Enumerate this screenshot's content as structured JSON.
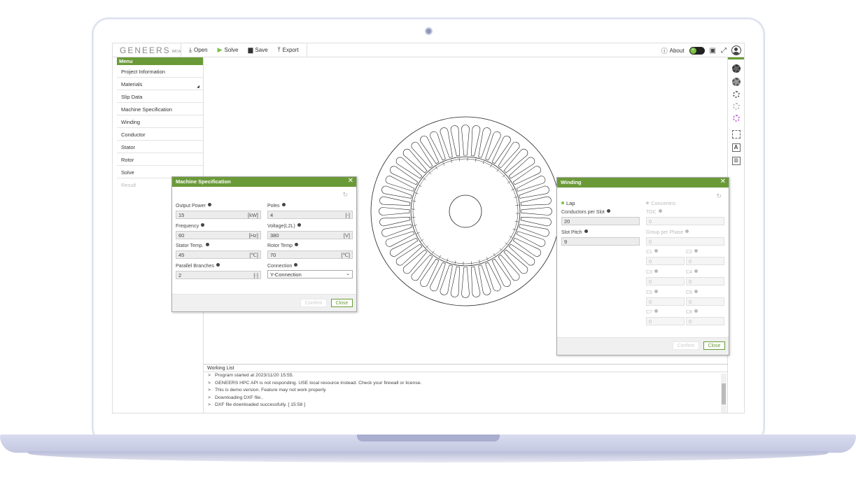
{
  "app": {
    "logo_text": "GENEERS",
    "logo_sub": "IMCA"
  },
  "toolbar": {
    "open_label": "Open",
    "solve_label": "Solve",
    "save_label": "Save",
    "export_label": "Export",
    "about_label": "About",
    "accent": "#6a9a38"
  },
  "sidebar": {
    "header": "Menu",
    "items": [
      {
        "label": "Project Information"
      },
      {
        "label": "Materials"
      },
      {
        "label": "Slip Data"
      },
      {
        "label": "Machine Specification"
      },
      {
        "label": "Winding"
      },
      {
        "label": "Conductor"
      },
      {
        "label": "Stator"
      },
      {
        "label": "Rotor"
      },
      {
        "label": "Solve"
      },
      {
        "label": "Result"
      }
    ]
  },
  "right_rail": {
    "icons": [
      "rotor-full-icon",
      "rotor-outline-icon",
      "stator-gear-icon",
      "stator-light-icon",
      "stator-highlight-icon",
      "fit-view-icon",
      "text-icon",
      "chart-icon"
    ]
  },
  "machine_spec": {
    "title": "Machine Specification",
    "output_power": {
      "label": "Output Power",
      "value": "15",
      "unit": "[kW]"
    },
    "poles": {
      "label": "Poles",
      "value": "4",
      "unit": "[-]"
    },
    "frequency": {
      "label": "Frequency",
      "value": "60",
      "unit": "[Hz]"
    },
    "voltage": {
      "label": "Voltage(L2L)",
      "value": "380",
      "unit": "[V]"
    },
    "stator_temp": {
      "label": "Stator Temp.",
      "value": "45",
      "unit": "[℃]"
    },
    "rotor_temp": {
      "label": "Rotor Temp",
      "value": "70",
      "unit": "[℃]"
    },
    "parallel_branches": {
      "label": "Parallel Branches",
      "value": "2",
      "unit": "[-]"
    },
    "connection": {
      "label": "Connection",
      "value": "Y-Connection"
    },
    "confirm_label": "Confirm",
    "close_label": "Close"
  },
  "winding": {
    "title": "Winding",
    "lap_label": "Lap",
    "concentric_label": "Concentric",
    "conductors_per_slot": {
      "label": "Conductors per Slot",
      "value": "20"
    },
    "slot_pitch": {
      "label": "Slot Pitch",
      "value": "9"
    },
    "toc": {
      "label": "TOC",
      "value": "0"
    },
    "group_per_phase": {
      "label": "Group per Phase",
      "value": "0"
    },
    "c": [
      {
        "label": "C1",
        "value": "0"
      },
      {
        "label": "C2",
        "value": "0"
      },
      {
        "label": "C3",
        "value": "0"
      },
      {
        "label": "C4",
        "value": "0"
      },
      {
        "label": "C5",
        "value": "0"
      },
      {
        "label": "C6",
        "value": "0"
      },
      {
        "label": "C7",
        "value": "0"
      },
      {
        "label": "C8",
        "value": "0"
      }
    ],
    "confirm_label": "Confirm",
    "close_label": "Close"
  },
  "working_list": {
    "title": "Working List",
    "lines": [
      "Program started at 2023/11/20 15:55.",
      "GENEERS HPC API is not responding. USE local resource instead. Check your firewall or license.",
      "This is demo version. Feature may not work properly.",
      "Downloading DXF file..",
      "DXF file downloaded successfully. [ 15:58 ]"
    ],
    "prompt": ">"
  }
}
